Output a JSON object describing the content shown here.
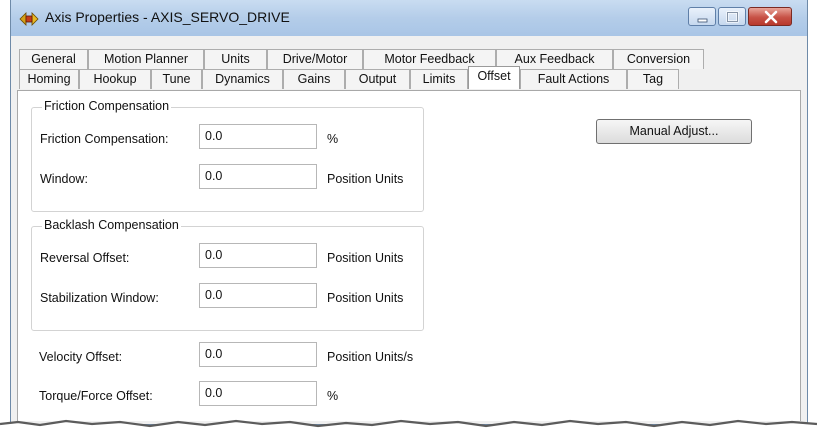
{
  "window": {
    "title": "Axis Properties - AXIS_SERVO_DRIVE",
    "icon": "axis-properties-icon",
    "controls": {
      "minimize": "minimize-icon",
      "maximize": "maximize-icon",
      "close": "close-icon"
    }
  },
  "tabs": {
    "row1": [
      "General",
      "Motion Planner",
      "Units",
      "Drive/Motor",
      "Motor Feedback",
      "Aux Feedback",
      "Conversion"
    ],
    "row2": [
      "Homing",
      "Hookup",
      "Tune",
      "Dynamics",
      "Gains",
      "Output",
      "Limits",
      "Offset",
      "Fault Actions",
      "Tag"
    ],
    "active": "Offset"
  },
  "friction": {
    "title": "Friction Compensation",
    "comp_label": "Friction Compensation:",
    "comp_value": "0.0",
    "comp_unit": "%",
    "window_label": "Window:",
    "window_value": "0.0",
    "window_unit": "Position Units"
  },
  "backlash": {
    "title": "Backlash Compensation",
    "reversal_label": "Reversal Offset:",
    "reversal_value": "0.0",
    "reversal_unit": "Position Units",
    "stab_label": "Stabilization Window:",
    "stab_value": "0.0",
    "stab_unit": "Position Units"
  },
  "offsets": {
    "velocity_label": "Velocity Offset:",
    "velocity_value": "0.0",
    "velocity_unit": "Position Units/s",
    "torque_label": "Torque/Force Offset:",
    "torque_value": "0.0",
    "torque_unit": "%"
  },
  "manual_adjust_label": "Manual Adjust..."
}
